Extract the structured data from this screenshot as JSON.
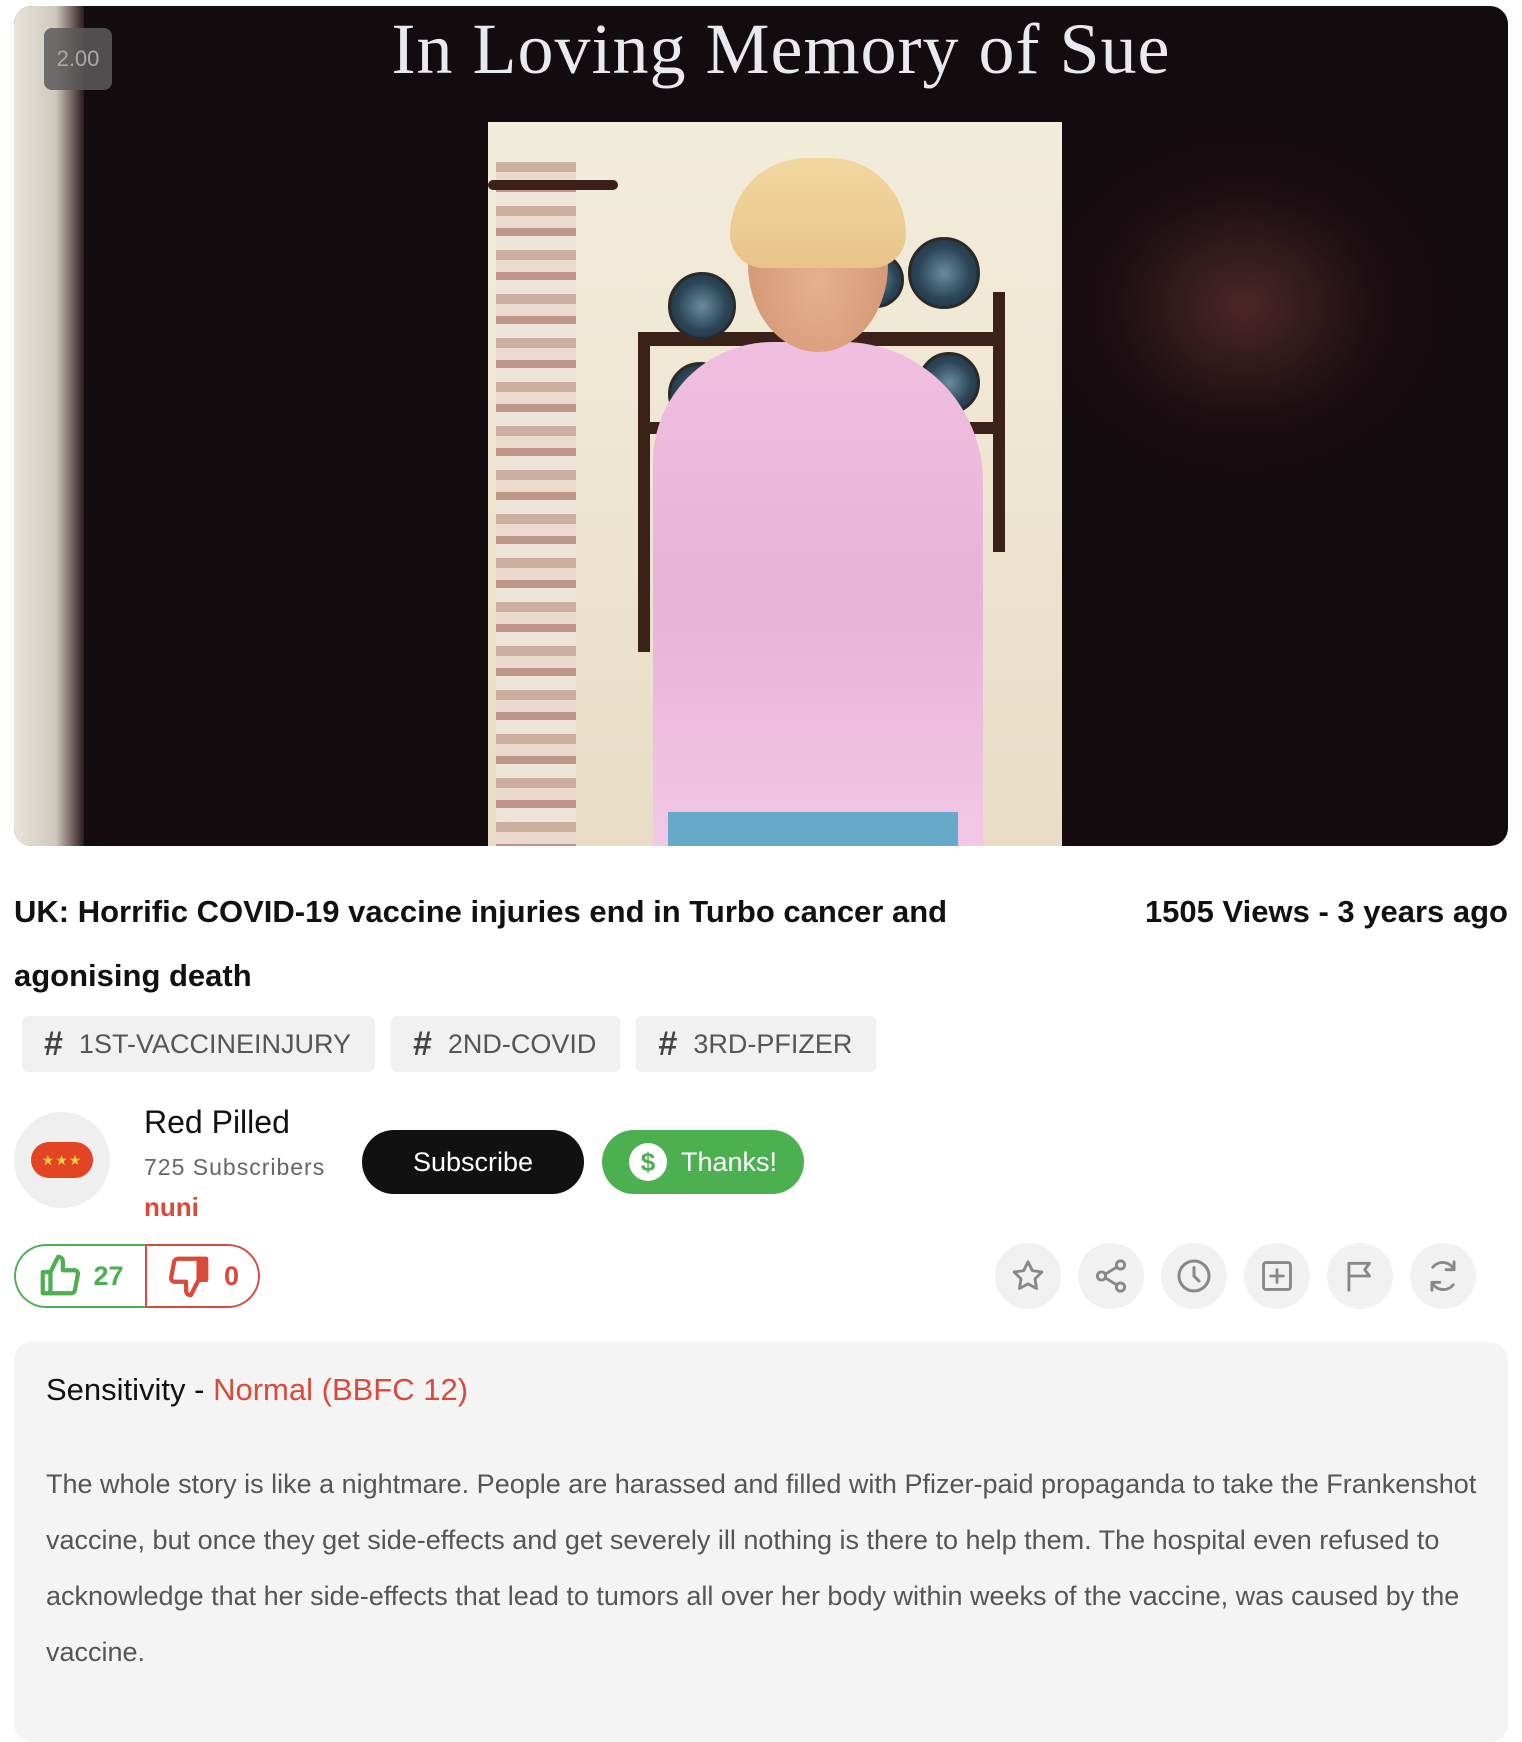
{
  "player": {
    "speed_badge": "2.00",
    "overlay_title": "In Loving Memory of Sue"
  },
  "video": {
    "title": "UK: Horrific COVID-19 vaccine injuries end in Turbo cancer and agonising death",
    "stats": "1505 Views - 3 years ago"
  },
  "tags": [
    {
      "label": "1ST-VACCINEINJURY",
      "icon": "hash-icon"
    },
    {
      "label": "2ND-COVID",
      "icon": "hash-icon"
    },
    {
      "label": "3RD-PFIZER",
      "icon": "hash-icon"
    }
  ],
  "channel": {
    "name": "Red Pilled",
    "subscribers": "725 Subscribers",
    "username": "nuni",
    "avatar_icon": "chat-bubble-stars-icon",
    "subscribe_label": "Subscribe",
    "thanks_label": "Thanks!",
    "thanks_icon": "dollar-icon"
  },
  "votes": {
    "likes": "27",
    "dislikes": "0",
    "like_color": "#4caf50",
    "dislike_color": "#d94a3a"
  },
  "actions": [
    {
      "name": "favorite",
      "icon": "star-icon"
    },
    {
      "name": "share",
      "icon": "share-icon"
    },
    {
      "name": "watch-later",
      "icon": "clock-icon"
    },
    {
      "name": "add-to-playlist",
      "icon": "plus-square-icon"
    },
    {
      "name": "report",
      "icon": "flag-icon"
    },
    {
      "name": "loop",
      "icon": "refresh-icon"
    }
  ],
  "description": {
    "sensitivity_label": "Sensitivity - ",
    "sensitivity_rating": "Normal (BBFC 12)",
    "text": "The whole story is like a nightmare. People are harassed and filled with Pfizer-paid propaganda to take the Frankenshot vaccine, but once they get side-effects and get severely ill nothing is there to help them. The hospital even refused to acknowledge that her side-effects that lead to tumors all over her body within weeks of the vaccine, was caused by the vaccine."
  }
}
